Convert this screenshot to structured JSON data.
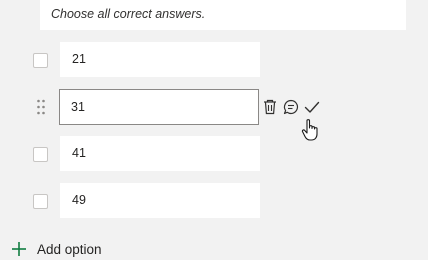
{
  "question": {
    "instructions": "Choose all correct answers."
  },
  "options": [
    {
      "value": "21"
    },
    {
      "value": "31"
    },
    {
      "value": "41"
    },
    {
      "value": "49"
    }
  ],
  "add_option": {
    "label": "Add option"
  },
  "colors": {
    "accent_green": "#107c41",
    "border": "#c8c6c4",
    "icon": "#323130"
  }
}
